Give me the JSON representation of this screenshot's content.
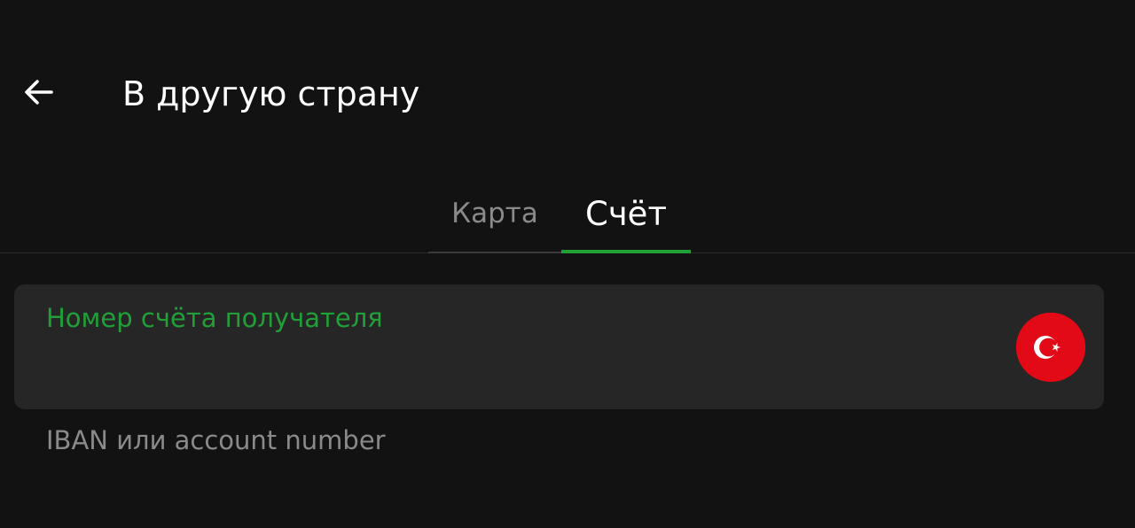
{
  "header": {
    "back_icon": "arrow-left-icon",
    "title": "В другую страну"
  },
  "tabs": [
    {
      "label": "Карта",
      "active": false
    },
    {
      "label": "Счёт",
      "active": true
    }
  ],
  "account_field": {
    "label": "Номер счёта получателя",
    "value": "",
    "flag_icon": "turkey-flag-icon",
    "helper": "IBAN или account number"
  },
  "colors": {
    "background": "#121212",
    "field_background": "#262626",
    "accent": "#21a038",
    "text_primary": "#ffffff",
    "text_secondary": "#8a8a8a",
    "flag_red": "#e30a17"
  }
}
